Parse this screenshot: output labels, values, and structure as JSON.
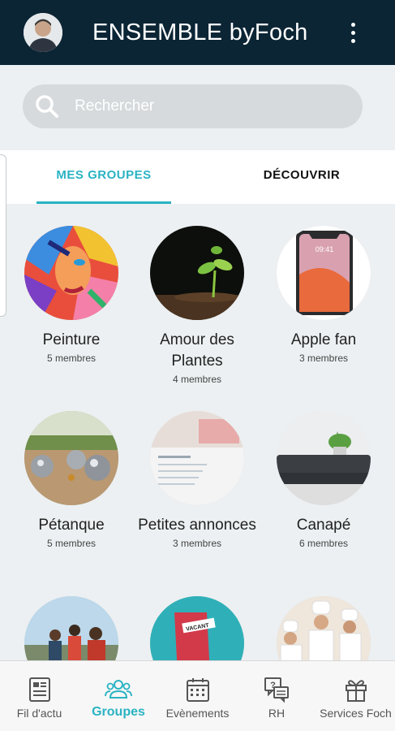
{
  "app": {
    "title": "ENSEMBLE byFoch"
  },
  "search": {
    "placeholder": "Rechercher"
  },
  "tabs": [
    {
      "label": "MES GROUPES",
      "active": true
    },
    {
      "label": "DÉCOUVRIR",
      "active": false
    }
  ],
  "groups": [
    {
      "name": "Peinture",
      "count": "5 membres"
    },
    {
      "name": "Amour des Plantes",
      "count": "4 membres"
    },
    {
      "name": "Apple fan",
      "count": "3 membres"
    },
    {
      "name": "Pétanque",
      "count": "5 membres"
    },
    {
      "name": "Petites annonces",
      "count": "3 membres"
    },
    {
      "name": "Canapé",
      "count": "6 membres"
    }
  ],
  "phone_screen_text": "09:41",
  "notice_text": "VACANT",
  "bottom_nav": [
    {
      "label": "Fil d'actu",
      "icon": "news-icon"
    },
    {
      "label": "Groupes",
      "icon": "groups-icon",
      "active": true
    },
    {
      "label": "Evènements",
      "icon": "calendar-icon"
    },
    {
      "label": "RH",
      "icon": "chat-question-icon"
    },
    {
      "label": "Services Foch",
      "icon": "gift-icon"
    }
  ],
  "colors": {
    "appbar": "#0b2535",
    "accent": "#2ab3c3",
    "background": "#ecf0f2"
  }
}
